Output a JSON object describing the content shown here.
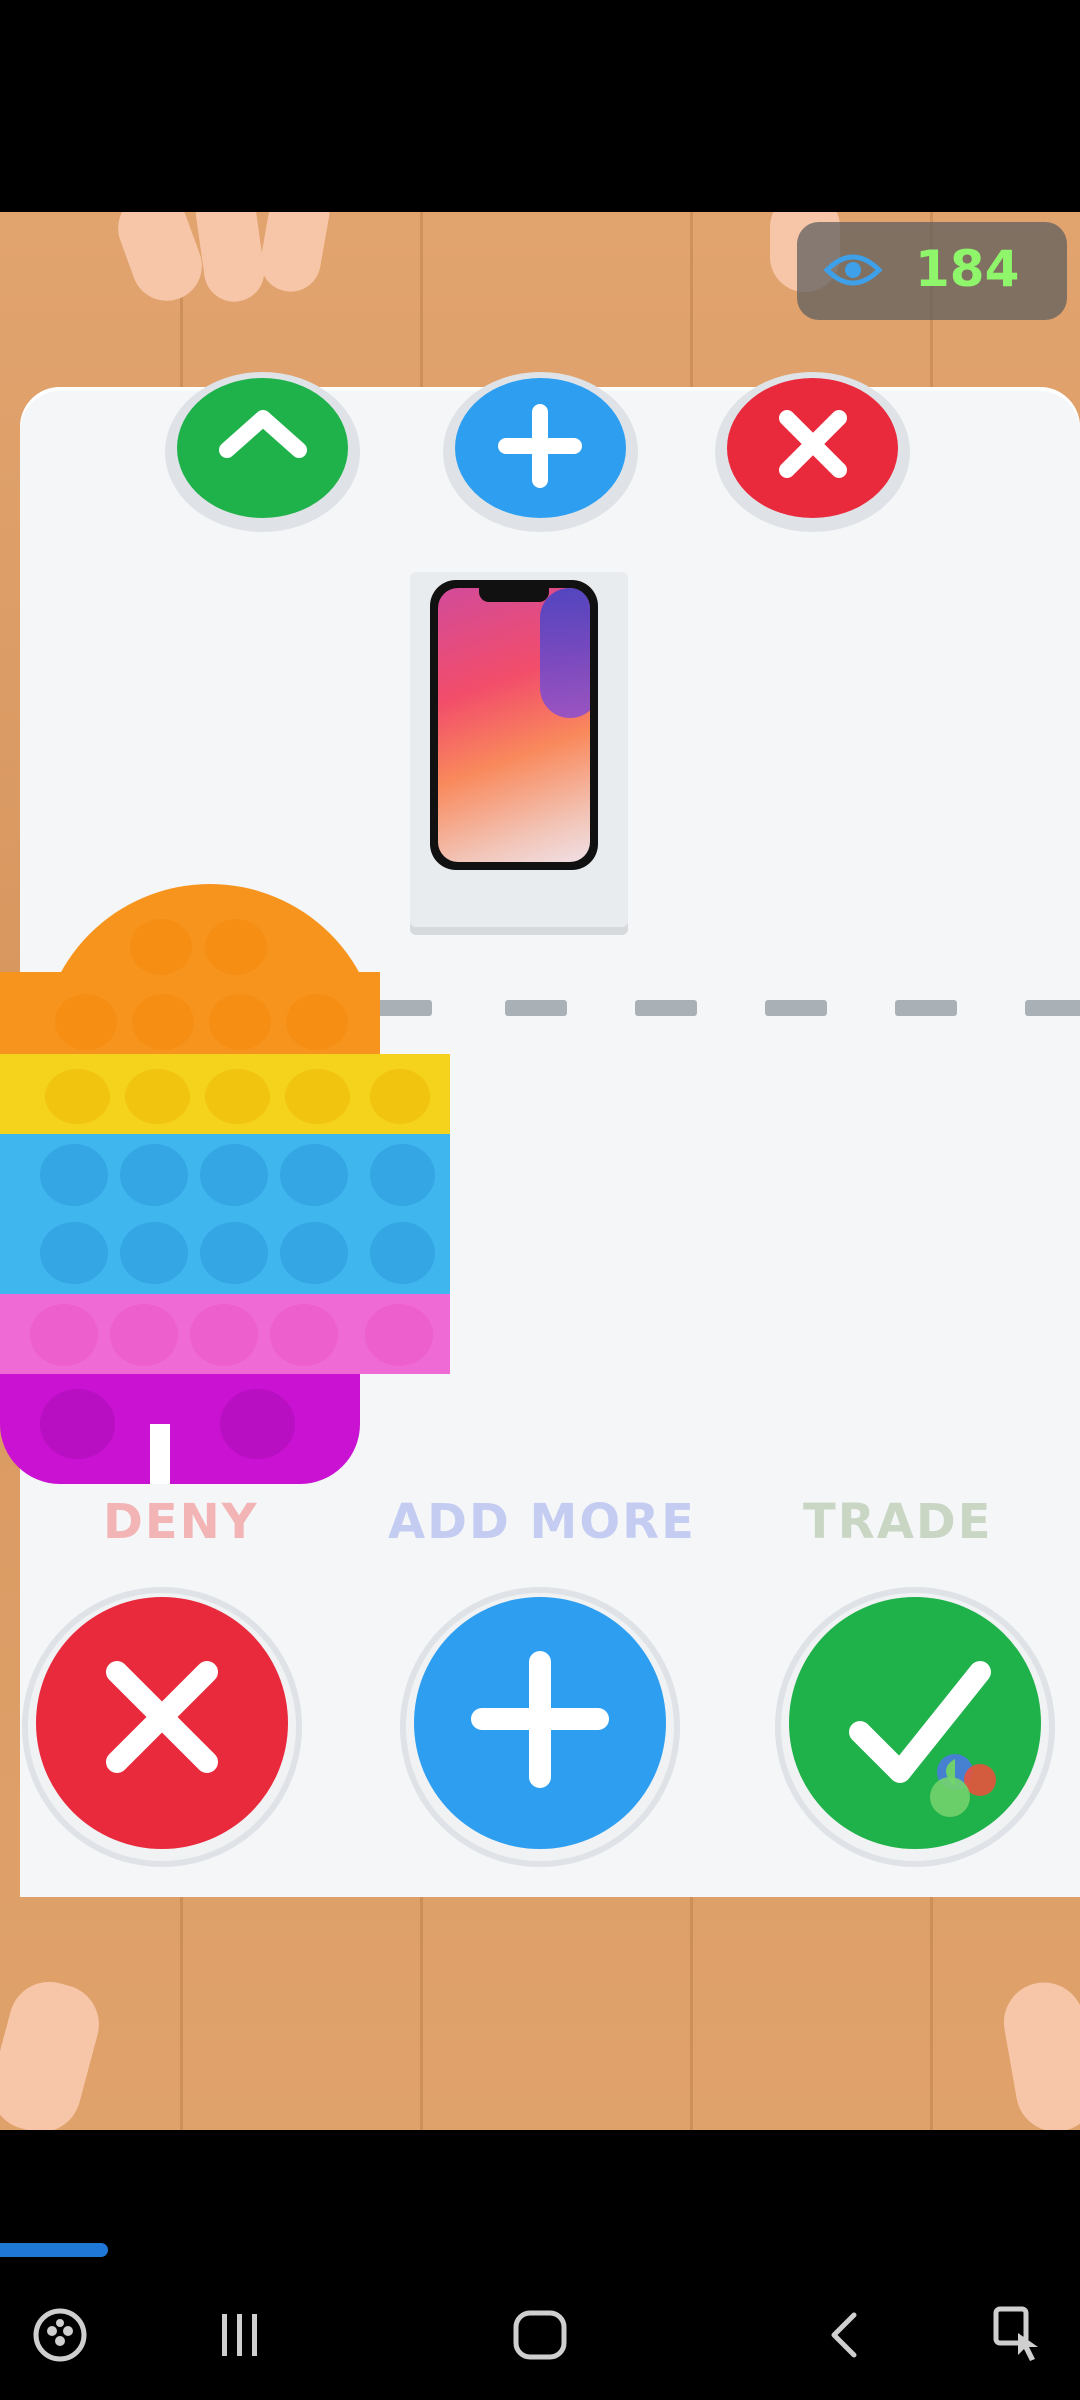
{
  "views": {
    "icon": "eye-icon",
    "count": "184"
  },
  "labels": {
    "deny": "DENY",
    "add_more": "ADD MORE",
    "trade": "TRADE"
  },
  "colors": {
    "green": "#1fb14a",
    "blue": "#2e9ff0",
    "red": "#e82a3c",
    "label_deny": "#f2b4b4",
    "label_add": "#c4ccf2",
    "label_trade": "#c9d6c4"
  },
  "progress": {
    "fraction": 0.1
  },
  "navbar": {
    "game_tools": "gamepad-icon",
    "recents": "recents-icon",
    "home": "home-icon",
    "back": "back-icon",
    "accessibility": "accessibility-icon"
  }
}
